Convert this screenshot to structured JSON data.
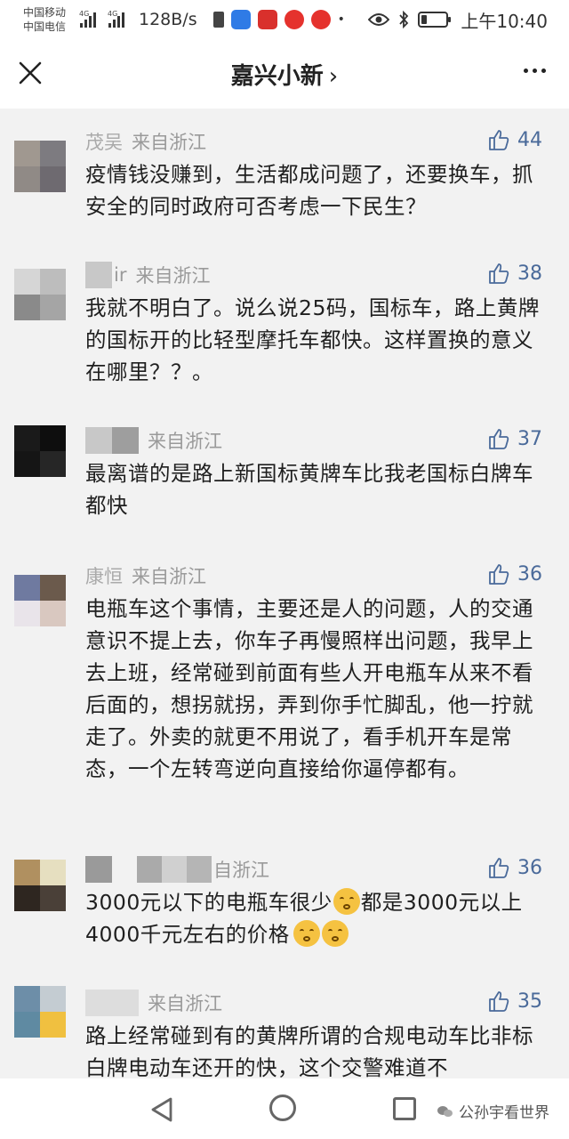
{
  "status_bar": {
    "carrier1": "中国移动",
    "carrier2": "中国电信",
    "net1": "4G",
    "net2": "4G",
    "speed": "128B/s",
    "time": "上午10:40",
    "battery_level": 0.2
  },
  "header": {
    "title": "嘉兴小新",
    "chevron": "›"
  },
  "comments": [
    {
      "name": "茂吴",
      "from": "来自浙江",
      "likes": "44",
      "text": "疫情钱没赚到，生活都成问题了，还要换车，抓安全的同时政府可否考虑一下民生？",
      "avatar_colors": [
        "#a09890",
        "#7d7b80",
        "#908a86",
        "#6e6a70"
      ]
    },
    {
      "name": "ir",
      "from": "来自浙江",
      "likes": "38",
      "text": "我就不明白了。说么说25码，国标车，路上黄牌的国标开的比轻型摩托车都快。这样置换的意义在哪里？？。",
      "avatar_colors": [
        "#d6d6d6",
        "#bdbdbd",
        "#8a8a8a",
        "#a5a5a5"
      ]
    },
    {
      "name": "",
      "from": "来自浙江",
      "likes": "37",
      "text": "最离谱的是路上新国标黄牌车比我老国标白牌车都快",
      "avatar_colors": [
        "#1a1a1a",
        "#0e0e0e",
        "#151515",
        "#262626"
      ]
    },
    {
      "name": "康恒",
      "from": "来自浙江",
      "likes": "36",
      "text": "电瓶车这个事情，主要还是人的问题，人的交通意识不提上去，你车子再慢照样出问题，我早上去上班，经常碰到前面有些人开电瓶车从来不看后面的，想拐就拐，弄到你手忙脚乱，他一拧就走了。外卖的就更不用说了，看手机开车是常态，一个左转弯逆向直接给你逼停都有。",
      "avatar_colors": [
        "#6f7aa0",
        "#6b5a4c",
        "#e9e4ea",
        "#d9c8c0"
      ]
    },
    {
      "name": "",
      "from": "自浙江",
      "likes": "36",
      "text_a": "3000元以下的电瓶车很少",
      "text_b": "都是3000元以上4000千元左右的价格",
      "avatar_colors": [
        "#b09060",
        "#e6dfc0",
        "#2e2620",
        "#4a4038"
      ]
    },
    {
      "name": "",
      "from": "来自浙江",
      "likes": "35",
      "text": "路上经常碰到有的黄牌所谓的合规电动车比非标白牌电动车还开的快，这个交警难道不",
      "avatar_colors": [
        "#6d8ea8",
        "#c4ccd2",
        "#5f8aa2",
        "#f0c040"
      ]
    }
  ],
  "watermark": "公孙宇看世界",
  "icons": {
    "close": "close-icon",
    "more": "more-icon",
    "like": "thumbs-up-icon",
    "back": "back-icon",
    "home": "home-icon",
    "recent": "recent-apps-icon"
  }
}
